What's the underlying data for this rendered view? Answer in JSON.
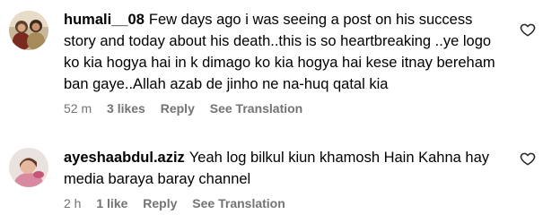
{
  "comments": [
    {
      "username": "humali__08",
      "text": "Few days ago i was seeing a post on his success story and today about his death..this is so heartbreaking ..ye logo ko kia hogya hai in k dimago ko kia hogya hai kese itnay bereham ban gaye..Allah azab de jinho ne na-huq qatal kia",
      "timestamp": "52 m",
      "likes_label": "3 likes",
      "reply_label": "Reply",
      "translation_label": "See Translation",
      "like_icon": "heart-outline-icon"
    },
    {
      "username": "ayeshaabdul.aziz",
      "text": "Yeah log bilkul kiun khamosh Hain Kahna hay media baraya baray channel",
      "timestamp": "2 h",
      "likes_label": "1 like",
      "reply_label": "Reply",
      "translation_label": "See Translation",
      "like_icon": "heart-outline-icon"
    }
  ],
  "colors": {
    "text": "#000000",
    "meta": "#737373",
    "background": "#ffffff"
  }
}
